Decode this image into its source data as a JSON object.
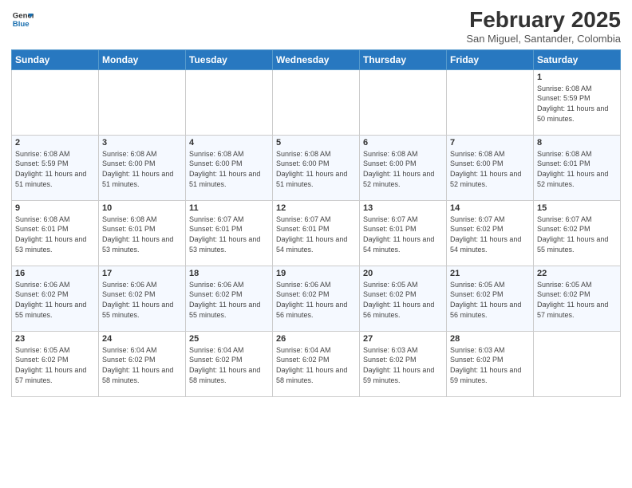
{
  "logo": {
    "line1": "General",
    "line2": "Blue"
  },
  "title": "February 2025",
  "location": "San Miguel, Santander, Colombia",
  "days_of_week": [
    "Sunday",
    "Monday",
    "Tuesday",
    "Wednesday",
    "Thursday",
    "Friday",
    "Saturday"
  ],
  "weeks": [
    [
      {
        "day": "",
        "info": ""
      },
      {
        "day": "",
        "info": ""
      },
      {
        "day": "",
        "info": ""
      },
      {
        "day": "",
        "info": ""
      },
      {
        "day": "",
        "info": ""
      },
      {
        "day": "",
        "info": ""
      },
      {
        "day": "1",
        "info": "Sunrise: 6:08 AM\nSunset: 5:59 PM\nDaylight: 11 hours and 50 minutes."
      }
    ],
    [
      {
        "day": "2",
        "info": "Sunrise: 6:08 AM\nSunset: 5:59 PM\nDaylight: 11 hours and 51 minutes."
      },
      {
        "day": "3",
        "info": "Sunrise: 6:08 AM\nSunset: 6:00 PM\nDaylight: 11 hours and 51 minutes."
      },
      {
        "day": "4",
        "info": "Sunrise: 6:08 AM\nSunset: 6:00 PM\nDaylight: 11 hours and 51 minutes."
      },
      {
        "day": "5",
        "info": "Sunrise: 6:08 AM\nSunset: 6:00 PM\nDaylight: 11 hours and 51 minutes."
      },
      {
        "day": "6",
        "info": "Sunrise: 6:08 AM\nSunset: 6:00 PM\nDaylight: 11 hours and 52 minutes."
      },
      {
        "day": "7",
        "info": "Sunrise: 6:08 AM\nSunset: 6:00 PM\nDaylight: 11 hours and 52 minutes."
      },
      {
        "day": "8",
        "info": "Sunrise: 6:08 AM\nSunset: 6:01 PM\nDaylight: 11 hours and 52 minutes."
      }
    ],
    [
      {
        "day": "9",
        "info": "Sunrise: 6:08 AM\nSunset: 6:01 PM\nDaylight: 11 hours and 53 minutes."
      },
      {
        "day": "10",
        "info": "Sunrise: 6:08 AM\nSunset: 6:01 PM\nDaylight: 11 hours and 53 minutes."
      },
      {
        "day": "11",
        "info": "Sunrise: 6:07 AM\nSunset: 6:01 PM\nDaylight: 11 hours and 53 minutes."
      },
      {
        "day": "12",
        "info": "Sunrise: 6:07 AM\nSunset: 6:01 PM\nDaylight: 11 hours and 54 minutes."
      },
      {
        "day": "13",
        "info": "Sunrise: 6:07 AM\nSunset: 6:01 PM\nDaylight: 11 hours and 54 minutes."
      },
      {
        "day": "14",
        "info": "Sunrise: 6:07 AM\nSunset: 6:02 PM\nDaylight: 11 hours and 54 minutes."
      },
      {
        "day": "15",
        "info": "Sunrise: 6:07 AM\nSunset: 6:02 PM\nDaylight: 11 hours and 55 minutes."
      }
    ],
    [
      {
        "day": "16",
        "info": "Sunrise: 6:06 AM\nSunset: 6:02 PM\nDaylight: 11 hours and 55 minutes."
      },
      {
        "day": "17",
        "info": "Sunrise: 6:06 AM\nSunset: 6:02 PM\nDaylight: 11 hours and 55 minutes."
      },
      {
        "day": "18",
        "info": "Sunrise: 6:06 AM\nSunset: 6:02 PM\nDaylight: 11 hours and 55 minutes."
      },
      {
        "day": "19",
        "info": "Sunrise: 6:06 AM\nSunset: 6:02 PM\nDaylight: 11 hours and 56 minutes."
      },
      {
        "day": "20",
        "info": "Sunrise: 6:05 AM\nSunset: 6:02 PM\nDaylight: 11 hours and 56 minutes."
      },
      {
        "day": "21",
        "info": "Sunrise: 6:05 AM\nSunset: 6:02 PM\nDaylight: 11 hours and 56 minutes."
      },
      {
        "day": "22",
        "info": "Sunrise: 6:05 AM\nSunset: 6:02 PM\nDaylight: 11 hours and 57 minutes."
      }
    ],
    [
      {
        "day": "23",
        "info": "Sunrise: 6:05 AM\nSunset: 6:02 PM\nDaylight: 11 hours and 57 minutes."
      },
      {
        "day": "24",
        "info": "Sunrise: 6:04 AM\nSunset: 6:02 PM\nDaylight: 11 hours and 58 minutes."
      },
      {
        "day": "25",
        "info": "Sunrise: 6:04 AM\nSunset: 6:02 PM\nDaylight: 11 hours and 58 minutes."
      },
      {
        "day": "26",
        "info": "Sunrise: 6:04 AM\nSunset: 6:02 PM\nDaylight: 11 hours and 58 minutes."
      },
      {
        "day": "27",
        "info": "Sunrise: 6:03 AM\nSunset: 6:02 PM\nDaylight: 11 hours and 59 minutes."
      },
      {
        "day": "28",
        "info": "Sunrise: 6:03 AM\nSunset: 6:02 PM\nDaylight: 11 hours and 59 minutes."
      },
      {
        "day": "",
        "info": ""
      }
    ]
  ]
}
